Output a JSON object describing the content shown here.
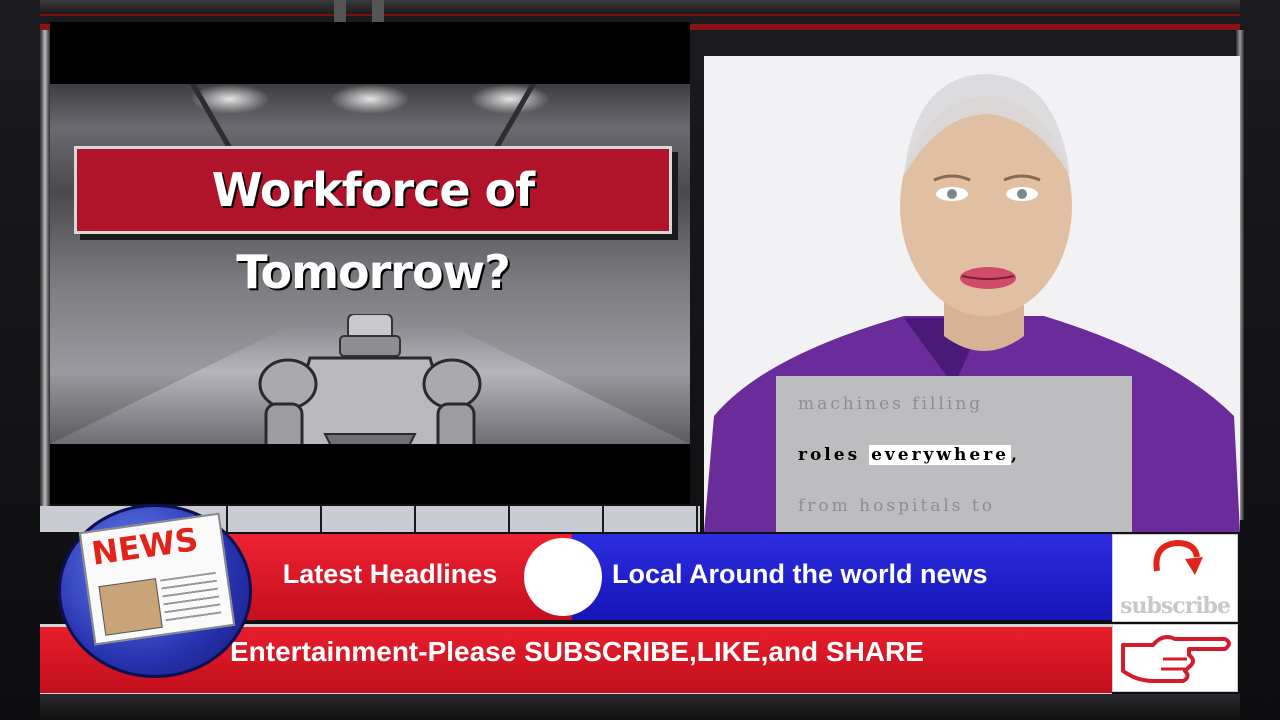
{
  "left_video": {
    "title": "Workforce of Tomorrow?"
  },
  "caption": {
    "line1": "machines filling",
    "line2_plain": "roles ",
    "line2_highlight": "everywhere",
    "line2_tail": ",",
    "line3": "from hospitals to"
  },
  "logo": {
    "news_word": "NEWS"
  },
  "ticker": {
    "headlines_label": "Latest Headlines",
    "blue_text": "Local Around the world news",
    "bottom_text": "Entertainment-Please SUBSCRIBE,LIKE,and SHARE"
  },
  "subscribe": {
    "label": "subscribe"
  },
  "colors": {
    "brand_red": "#e81e2c",
    "brand_blue": "#1f1fcf",
    "title_red": "#b0132a"
  },
  "icons": [
    "subscribe-arrow-icon",
    "pointing-hand-icon",
    "newspaper-icon"
  ]
}
